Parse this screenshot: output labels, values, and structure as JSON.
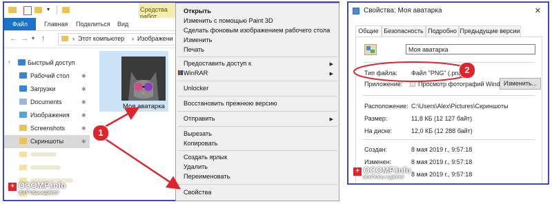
{
  "explorer": {
    "ribbon": {
      "file": "Файл",
      "home": "Главная",
      "share": "Поделиться",
      "view": "Вид",
      "context": "Средства работ"
    },
    "breadcrumb": [
      "Этот компьютер",
      "Изображени"
    ],
    "nav": [
      {
        "label": "Быстрый доступ",
        "color": "#3b82d6",
        "pin": ""
      },
      {
        "label": "Рабочий стол",
        "color": "#3b82d6",
        "pin": "✱"
      },
      {
        "label": "Загрузки",
        "color": "#3b82d6",
        "pin": "✱"
      },
      {
        "label": "Documents",
        "color": "#3b82d6",
        "pin": "✱"
      },
      {
        "label": "Изображения",
        "color": "#3b82d6",
        "pin": "✱"
      },
      {
        "label": "Screenshots",
        "color": "#e8c35a",
        "pin": "✱"
      },
      {
        "label": "Скриншоты",
        "color": "#e8c35a",
        "pin": "✱"
      }
    ],
    "file_label": "Моя аватарка"
  },
  "context_menu": {
    "items": [
      {
        "label": "Открыть",
        "bold": true
      },
      {
        "label": "Изменить с помощью Paint 3D"
      },
      {
        "label": "Сделать фоновым изображением рабочего стола"
      },
      {
        "label": "Изменить"
      },
      {
        "label": "Печать"
      },
      {
        "label": "Предоставить доступ к",
        "arrow": true
      },
      {
        "label": "WinRAR",
        "arrow": true
      },
      {
        "label": "Unlocker"
      },
      {
        "label": "Восстановить прежнюю версию"
      },
      {
        "label": "Отправить",
        "arrow": true
      },
      {
        "label": "Вырезать"
      },
      {
        "label": "Копировать"
      },
      {
        "label": "Создать ярлык"
      },
      {
        "label": "Удалить"
      },
      {
        "label": "Переименовать"
      },
      {
        "label": "Свойства"
      }
    ]
  },
  "properties": {
    "title": "Свойства: Моя аватарка",
    "close": "✕",
    "tabs": [
      "Общие",
      "Безопасность",
      "Подробно",
      "Предыдущие версии"
    ],
    "name_value": "Моя аватарка",
    "type_label": "Тип файла:",
    "type_value": "Файл \"PNG\" (.png)",
    "app_label": "Приложение:",
    "app_value": "Просмотр фотографий Windows",
    "change_button": "Изменить...",
    "location_label": "Расположение:",
    "location_value": "C:\\Users\\Alex\\Pictures\\Скриншоты",
    "size_label": "Размер:",
    "size_value": "11,8 КБ (12 127 байт)",
    "disk_label": "На диске:",
    "disk_value": "12,0 КБ (12 288 байт)",
    "created_label": "Создан:",
    "created_value": "8 мая 2019 г., 9:57:18",
    "modified_label": "Изменен:",
    "modified_value": "8 мая 2019 г., 9:57:18",
    "opened_value": "8 мая 2019 г., 9:57:18"
  },
  "annotations": {
    "one": "1",
    "two": "2"
  },
  "watermark": {
    "text": "OCOMP.info",
    "sub": "ВОПРОСЫ АДМИНУ"
  },
  "colors": {
    "accent": "#e0242b",
    "frame": "#3a4bb8",
    "file_tab": "#1a73c6",
    "selection": "#cce4f7"
  }
}
